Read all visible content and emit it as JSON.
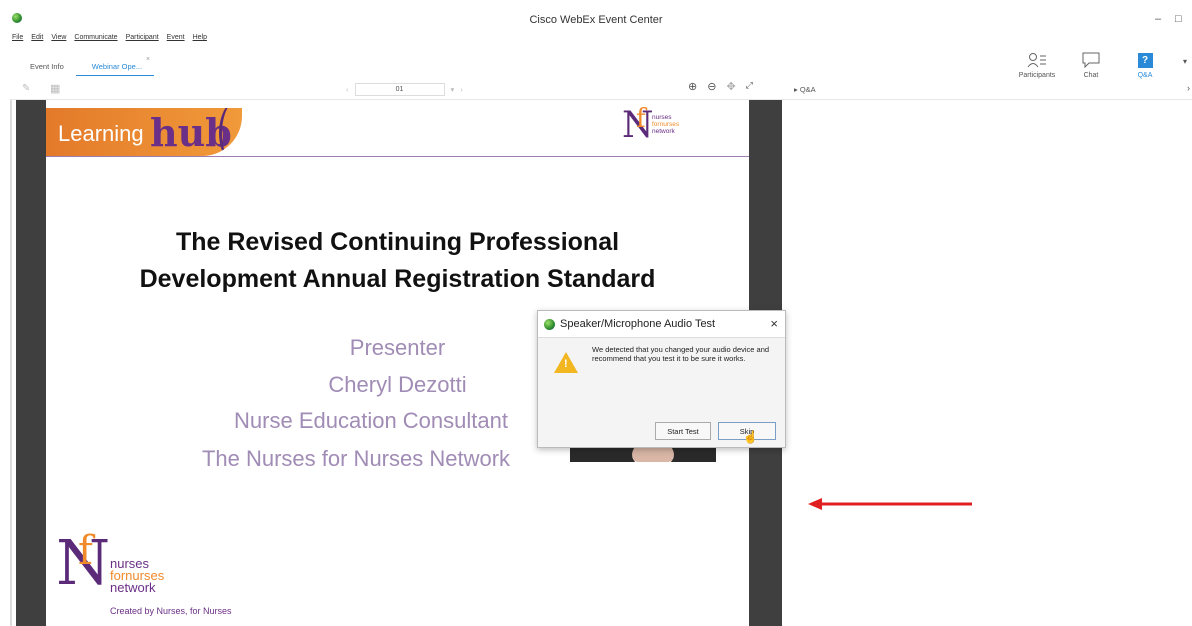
{
  "window": {
    "title": "Cisco WebEx Event Center",
    "minimize": "–",
    "maximize": "□"
  },
  "menu": [
    "File",
    "Edit",
    "View",
    "Communicate",
    "Participant",
    "Event",
    "Help"
  ],
  "tabs": [
    {
      "label": "Event Info"
    },
    {
      "label": "Webinar Ope...",
      "close": "×"
    }
  ],
  "panels": [
    {
      "label": "Participants"
    },
    {
      "label": "Chat"
    },
    {
      "label": "Q&A",
      "badge": "?"
    }
  ],
  "toolbar": {
    "page": "01",
    "qa_label": "▸ Q&A",
    "close_panel": "›"
  },
  "slide": {
    "banner_learning": "Learning",
    "banner_hub": "hub",
    "logo_small": {
      "line1": "nurses",
      "line2": "fornurses",
      "line3": "network"
    },
    "title_line1": "The Revised Continuing Professional",
    "title_line2": "Development Annual Registration Standard",
    "presenter_label": "Presenter",
    "presenter_name": "Cheryl Dezotti",
    "presenter_role": "Nurse Education Consultant",
    "presenter_org": "The Nurses for Nurses Network",
    "logo_large": {
      "line1": "nurses",
      "line2": "fornurses",
      "line3": "network",
      "tagline": "Created by Nurses, for Nurses"
    }
  },
  "dialog": {
    "title": "Speaker/Microphone Audio Test",
    "close": "×",
    "message": "We detected that you changed your audio device and recommend that you test it to be sure it works.",
    "start_button": "Start Test",
    "skip_button": "Skip"
  },
  "colors": {
    "accent": "#2b8ad7",
    "arrow": "#e02020",
    "brand_purple": "#5b2b7a",
    "brand_orange": "#f08a2a"
  }
}
